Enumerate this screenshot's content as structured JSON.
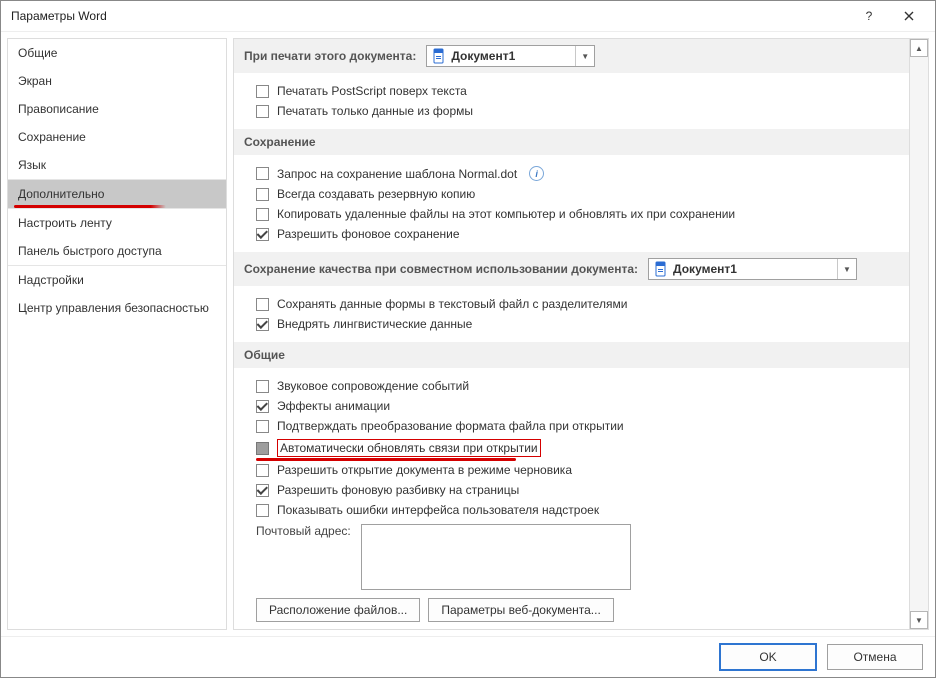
{
  "window": {
    "title": "Параметры Word"
  },
  "sidebar": {
    "items": [
      {
        "label": "Общие"
      },
      {
        "label": "Экран"
      },
      {
        "label": "Правописание"
      },
      {
        "label": "Сохранение"
      },
      {
        "label": "Язык"
      },
      {
        "label": "Дополнительно"
      },
      {
        "label": "Настроить ленту"
      },
      {
        "label": "Панель быстрого доступа"
      },
      {
        "label": "Надстройки"
      },
      {
        "label": "Центр управления безопасностью"
      }
    ]
  },
  "content": {
    "sec_print": {
      "header": "При печати этого документа:",
      "doc_combo": "Документ1",
      "opts": {
        "postscript": "Печатать PostScript поверх текста",
        "formdata": "Печатать только данные из формы"
      }
    },
    "sec_save": {
      "header": "Сохранение",
      "opts": {
        "normaldot": "Запрос на сохранение шаблона Normal.dot",
        "backup": "Всегда создавать резервную копию",
        "copyremote": "Копировать удаленные файлы на этот компьютер и обновлять их при сохранении",
        "bgsave": "Разрешить фоновое сохранение"
      }
    },
    "sec_compat": {
      "header": "Сохранение качества при совместном использовании документа:",
      "doc_combo": "Документ1",
      "opts": {
        "formtxt": "Сохранять данные формы в текстовый файл с разделителями",
        "ling": "Внедрять лингвистические данные"
      }
    },
    "sec_general": {
      "header": "Общие",
      "opts": {
        "sound": "Звуковое сопровождение событий",
        "anim": "Эффекты анимации",
        "confirmconv": "Подтверждать преобразование формата файла при открытии",
        "autolinks": "Автоматически обновлять связи при открытии",
        "draftopen": "Разрешить открытие документа в режиме черновика",
        "bgrepag": "Разрешить фоновую разбивку на страницы",
        "showaddinerr": "Показывать ошибки интерфейса пользователя надстроек"
      },
      "mailing_label": "Почтовый адрес:",
      "btn_fileloc": "Расположение файлов...",
      "btn_webopt": "Параметры веб-документа..."
    }
  },
  "footer": {
    "ok": "OK",
    "cancel": "Отмена"
  }
}
